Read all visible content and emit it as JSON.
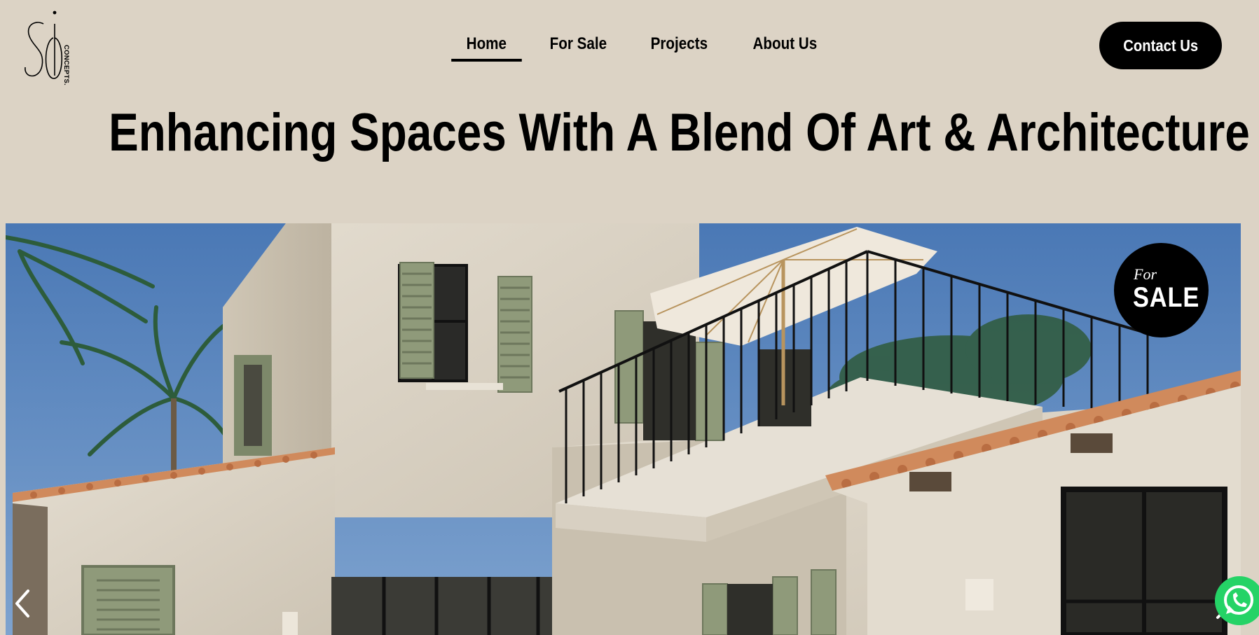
{
  "logo": {
    "mark": "SO",
    "wordmark": "CONCEPTS."
  },
  "nav": {
    "items": [
      {
        "label": "Home",
        "active": true
      },
      {
        "label": "For Sale",
        "active": false
      },
      {
        "label": "Projects",
        "active": false
      },
      {
        "label": "About Us",
        "active": false
      }
    ]
  },
  "header": {
    "contact_label": "Contact Us"
  },
  "hero": {
    "title": "Enhancing Spaces With A Blend Of Art & Architecture",
    "badge_for": "For",
    "badge_sale": "SALE"
  },
  "colors": {
    "background": "#dcd3c5",
    "accent": "#000000",
    "whatsapp": "#25d366",
    "shutter_green": "#8f9a7a",
    "roof_terracotta": "#d08a5c",
    "sky": "#4f7fb8"
  },
  "icons": {
    "prev": "chevron-left-icon",
    "next": "chevron-right-icon",
    "chat": "whatsapp-icon"
  }
}
